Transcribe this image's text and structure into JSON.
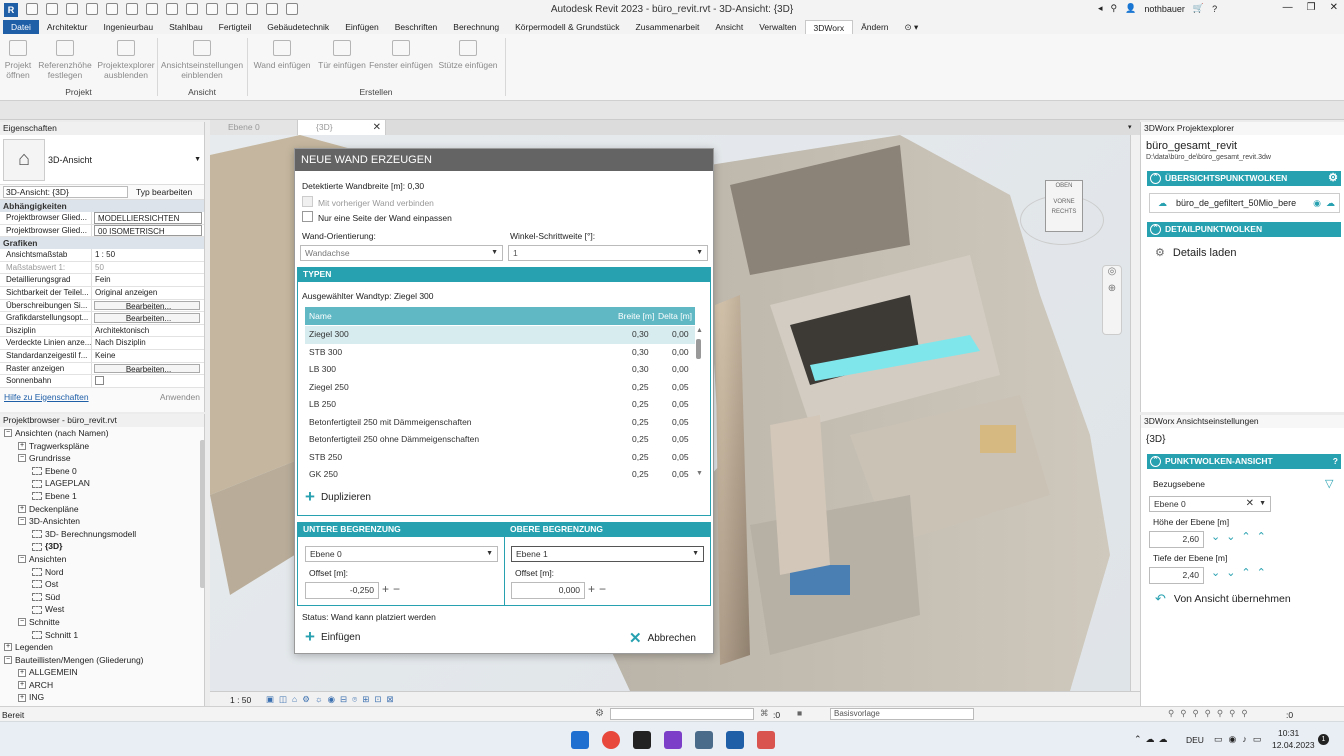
{
  "titlebar": {
    "title": "Autodesk Revit 2023 - büro_revit.rvt - 3D-Ansicht: {3D}",
    "user": "nothbauer",
    "logo": "R"
  },
  "ribbon_tabs": [
    "Datei",
    "Architektur",
    "Ingenieurbau",
    "Stahlbau",
    "Fertigteil",
    "Gebäudetechnik",
    "Einfügen",
    "Beschriften",
    "Berechnung",
    "Körpermodell & Grundstück",
    "Zusammenarbeit",
    "Ansicht",
    "Verwalten",
    "3DWorx",
    "Ändern"
  ],
  "ribbon": {
    "buttons": [
      {
        "label": "Projekt\nöffnen"
      },
      {
        "label": "Referenzhöhe\nfestlegen"
      },
      {
        "label": "Projektexplorer\nausblenden"
      },
      {
        "label": "Ansichtseinstellungen\neinblenden"
      },
      {
        "label": "Wand einfügen"
      },
      {
        "label": "Tür einfügen"
      },
      {
        "label": "Fenster einfügen"
      },
      {
        "label": "Stütze einfügen"
      }
    ],
    "panels": {
      "projekt": "Projekt",
      "ansicht": "Ansicht",
      "erstellen": "Erstellen"
    }
  },
  "properties": {
    "header": "Eigenschaften",
    "type_name": "3D-Ansicht",
    "selector": "3D-Ansicht: {3D}",
    "edit_type": "Typ bearbeiten",
    "group1": "Abhängigkeiten",
    "group2": "Grafiken",
    "rows1": [
      {
        "k": "Projektbrowser Glied...",
        "v": "MODELLIERSICHTEN"
      },
      {
        "k": "Projektbrowser Glied...",
        "v": "00 ISOMETRISCH"
      }
    ],
    "rows2": [
      {
        "k": "Ansichtsmaßstab",
        "v": "1 : 50"
      },
      {
        "k": "Maßstabswert 1:",
        "v": "50"
      },
      {
        "k": "Detaillierungsgrad",
        "v": "Fein"
      },
      {
        "k": "Sichtbarkeit der Teilel...",
        "v": "Original anzeigen"
      },
      {
        "k": "Überschreibungen Si...",
        "v": "Bearbeiten..."
      },
      {
        "k": "Grafikdarstellungsopt...",
        "v": "Bearbeiten..."
      },
      {
        "k": "Disziplin",
        "v": "Architektonisch"
      },
      {
        "k": "Verdeckte Linien anze...",
        "v": "Nach Disziplin"
      },
      {
        "k": "Standardanzeigestil f...",
        "v": "Keine"
      },
      {
        "k": "Raster anzeigen",
        "v": "Bearbeiten..."
      },
      {
        "k": "Sonnenbahn",
        "v": ""
      }
    ],
    "help_link": "Hilfe zu Eigenschaften",
    "apply": "Anwenden"
  },
  "project_browser": {
    "header": "Projektbrowser - büro_revit.rvt",
    "nodes": [
      {
        "t": "Ansichten (nach Namen)",
        "lvl": 0,
        "tog": "−"
      },
      {
        "t": "Tragwerkspläne",
        "lvl": 1,
        "tog": "+"
      },
      {
        "t": "Grundrisse",
        "lvl": 1,
        "tog": "−"
      },
      {
        "t": "Ebene 0",
        "lvl": 2,
        "tog": ""
      },
      {
        "t": "LAGEPLAN",
        "lvl": 2,
        "tog": ""
      },
      {
        "t": "Ebene 1",
        "lvl": 2,
        "tog": ""
      },
      {
        "t": "Deckenpläne",
        "lvl": 1,
        "tog": "+"
      },
      {
        "t": "3D-Ansichten",
        "lvl": 1,
        "tog": "−"
      },
      {
        "t": "3D- Berechnungsmodell",
        "lvl": 2,
        "tog": ""
      },
      {
        "t": "{3D}",
        "lvl": 2,
        "tog": ""
      },
      {
        "t": "Ansichten",
        "lvl": 1,
        "tog": "−"
      },
      {
        "t": "Nord",
        "lvl": 2,
        "tog": ""
      },
      {
        "t": "Ost",
        "lvl": 2,
        "tog": ""
      },
      {
        "t": "Süd",
        "lvl": 2,
        "tog": ""
      },
      {
        "t": "West",
        "lvl": 2,
        "tog": ""
      },
      {
        "t": "Schnitte",
        "lvl": 1,
        "tog": "−"
      },
      {
        "t": "Schnitt 1",
        "lvl": 2,
        "tog": ""
      },
      {
        "t": "Legenden",
        "lvl": 0,
        "tog": "+"
      },
      {
        "t": "Bauteillisten/Mengen (Gliederung)",
        "lvl": 0,
        "tog": "−"
      },
      {
        "t": "ALLGEMEIN",
        "lvl": 1,
        "tog": "+"
      },
      {
        "t": "ARCH",
        "lvl": 1,
        "tog": "+"
      },
      {
        "t": "ING",
        "lvl": 1,
        "tog": "+"
      }
    ]
  },
  "view_tabs": [
    {
      "label": "Ebene 0"
    },
    {
      "label": "{3D}"
    }
  ],
  "viewcube": {
    "top": "OBEN",
    "front": "VORNE",
    "right": "RECHTS"
  },
  "dialog": {
    "title": "NEUE WAND ERZEUGEN",
    "detected_width": "Detektierte Wandbreite [m]: 0,30",
    "cb_connect": "Mit vorheriger Wand verbinden",
    "cb_one_side": "Nur eine Seite der Wand einpassen",
    "orientation_label": "Wand-Orientierung:",
    "orientation_value": "Wandachse",
    "angle_label": "Winkel-Schrittweite [°]:",
    "angle_value": "1",
    "types_header": "TYPEN",
    "selected_type": "Ausgewählter Wandtyp:  Ziegel 300",
    "col_name": "Name",
    "col_width": "Breite [m]",
    "col_delta": "Delta [m]",
    "rows": [
      {
        "n": "Ziegel 300",
        "b": "0,30",
        "d": "0,00"
      },
      {
        "n": "STB 300",
        "b": "0,30",
        "d": "0,00"
      },
      {
        "n": "LB 300",
        "b": "0,30",
        "d": "0,00"
      },
      {
        "n": "Ziegel 250",
        "b": "0,25",
        "d": "0,05"
      },
      {
        "n": "LB 250",
        "b": "0,25",
        "d": "0,05"
      },
      {
        "n": "Betonfertigteil 250 mit Dämmeigenschaften",
        "b": "0,25",
        "d": "0,05"
      },
      {
        "n": "Betonfertigteil 250 ohne Dämmeigenschaften",
        "b": "0,25",
        "d": "0,05"
      },
      {
        "n": "STB 250",
        "b": "0,25",
        "d": "0,05"
      },
      {
        "n": "GK 250",
        "b": "0,25",
        "d": "0,05"
      }
    ],
    "duplicate": "Duplizieren",
    "lower_header": "UNTERE BEGRENZUNG",
    "upper_header": "OBERE BEGRENZUNG",
    "lower_level": "Ebene 0",
    "upper_level": "Ebene 1",
    "offset_label": "Offset [m]:",
    "lower_offset": "-0,250",
    "upper_offset": "0,000",
    "status": "Status: Wand kann platziert werden",
    "insert": "Einfügen",
    "cancel": "Abbrechen"
  },
  "explorer": {
    "header": "3DWorx Projektexplorer",
    "project": "büro_gesamt_revit",
    "path": "D:\\data\\büro_de\\büro_gesamt_revit.3dw",
    "overview": "ÜBERSICHTSPUNKTWOLKEN",
    "cloud_item": "büro_de_gefiltert_50Mio_bere",
    "detail": "DETAILPUNKTWOLKEN",
    "load_details": "Details laden"
  },
  "view_settings": {
    "header": "3DWorx Ansichtseinstellungen",
    "view": "{3D}",
    "section": "PUNKTWOLKEN-ANSICHT",
    "ref_level_label": "Bezugsebene",
    "ref_level_value": "Ebene 0",
    "height_label": "Höhe der Ebene [m]",
    "height_value": "2,60",
    "depth_label": "Tiefe der Ebene [m]",
    "depth_value": "2,40",
    "adopt": "Von Ansicht übernehmen"
  },
  "view_status": {
    "scale": "1 : 50"
  },
  "statusbar": {
    "left": "Bereit",
    "zero": ":0",
    "template": "Basisvorlage",
    "right_zero": ":0"
  },
  "taskbar": {
    "lang": "DEU",
    "time": "10:31",
    "date": "12.04.2023",
    "notif": "1"
  },
  "colors": {
    "accent": "#27a0b0",
    "revit_blue": "#1f5fa8",
    "dialog_title": "#646464"
  }
}
